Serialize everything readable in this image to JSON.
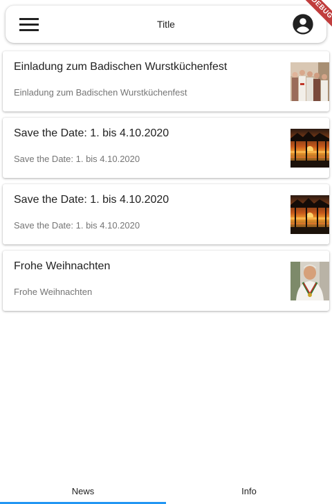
{
  "appbar": {
    "title": "Title",
    "menu_icon": "menu-icon",
    "account_icon": "account-circle-icon"
  },
  "debug_banner": "DEBUG",
  "news": [
    {
      "title": "Einladung zum Badischen Wurstküchenfest",
      "subtitle": "Einladung zum Badischen Wurstküchenfest",
      "image": "group-photo"
    },
    {
      "title": "Save the Date: 1. bis 4.10.2020",
      "subtitle": "Save the Date: 1. bis 4.10.2020",
      "image": "sunset-photo"
    },
    {
      "title": "Save the Date: 1. bis 4.10.2020",
      "subtitle": "Save the Date: 1. bis 4.10.2020",
      "image": "sunset-photo"
    },
    {
      "title": "Frohe Weihnachten",
      "subtitle": "Frohe Weihnachten",
      "image": "portrait-photo"
    }
  ],
  "bottom_nav": {
    "items": [
      {
        "label": "News",
        "active": true
      },
      {
        "label": "Info",
        "active": false
      }
    ],
    "accent_color": "#2196f3"
  }
}
